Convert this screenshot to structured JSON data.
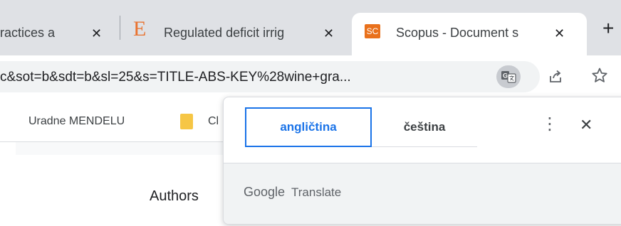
{
  "browser": {
    "tabs": [
      {
        "label": "ractices a",
        "close": "✕"
      },
      {
        "label": "Regulated deficit irrig",
        "close": "✕",
        "favicon": "E"
      },
      {
        "label": "Scopus - Document s",
        "close": "✕",
        "favicon": "SC",
        "active": true
      }
    ],
    "new_tab": "+",
    "url": "c&sot=b&sdt=b&sl=25&s=TITLE-ABS-KEY%28wine+gra...",
    "bookmarks": [
      {
        "label": "Uradne MENDELU"
      },
      {
        "label": "Cl"
      }
    ]
  },
  "page": {
    "authors_label": "Authors"
  },
  "translate_popup": {
    "source_lang": "angličtina",
    "target_lang": "čeština",
    "more": "⋮",
    "close": "✕",
    "brand_google": "Google",
    "brand_translate": "Translate"
  },
  "colors": {
    "tabstrip": "#dfe1e5",
    "accent": "#1a73e8",
    "scopus_orange": "#e9711c",
    "folder": "#f6c645"
  },
  "icons": {
    "translate": "translate-icon",
    "share": "share-icon",
    "star": "star-icon",
    "folder": "folder-icon"
  }
}
